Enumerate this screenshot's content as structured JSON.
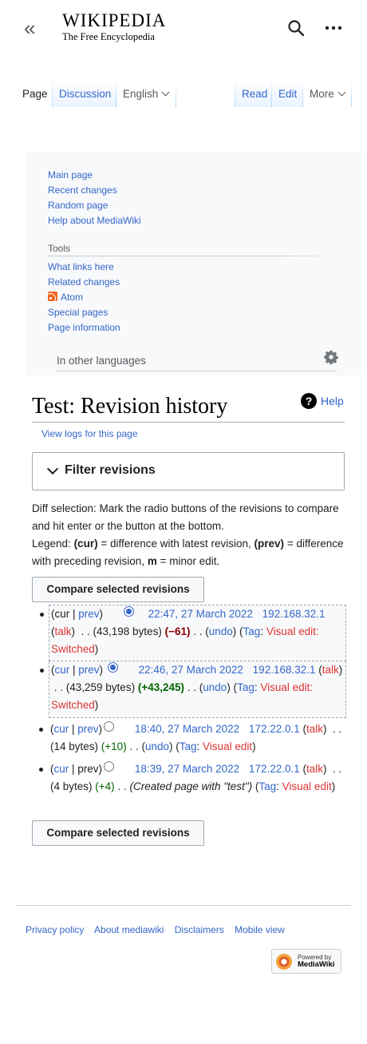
{
  "header": {
    "logo_word": "WIKIPEDIA",
    "logo_tagline": "The Free Encyclopedia",
    "collapse_glyph": "«",
    "icons": [
      "double-chevron-left-icon",
      "search-icon",
      "ellipsis-icon"
    ]
  },
  "tabs": {
    "page": "Page",
    "discussion": "Discussion",
    "language": "English",
    "read": "Read",
    "edit": "Edit",
    "more": "More"
  },
  "sidebar": {
    "nav": [
      "Main page",
      "Recent changes",
      "Random page",
      "Help about MediaWiki"
    ],
    "tools_heading": "Tools",
    "tools": [
      "What links here",
      "Related changes",
      "Atom",
      "Special pages",
      "Page information"
    ],
    "other_languages": "In other languages"
  },
  "page": {
    "title": "Test: Revision history",
    "help": "Help",
    "view_logs": "View logs for this page",
    "filter_label": "Filter revisions",
    "diff_selection": "Diff selection: Mark the radio buttons of the revisions to compare and hit enter or the button at the bottom.",
    "legend_prefix": "Legend: ",
    "legend_cur": "(cur)",
    "legend_cur_desc": " = difference with latest revision, ",
    "legend_prev": "(prev)",
    "legend_prev_desc": " = difference with preceding revision, ",
    "legend_m": "m",
    "legend_m_desc": " = minor edit.",
    "compare_button": "Compare selected revisions"
  },
  "revisions": [
    {
      "cur": "cur",
      "prev": "prev",
      "date": "22:47, 27 March 2022",
      "user": "192.168.32.1",
      "talk": "talk",
      "bytes": "(43,198 bytes)",
      "delta": "(−61)",
      "delta_kind": "neg",
      "undo": "undo",
      "tag_label": "Tag",
      "tag": "Visual edit: Switched",
      "summary": ""
    },
    {
      "cur": "cur",
      "prev": "prev",
      "date": "22:46, 27 March 2022",
      "user": "192.168.32.1",
      "talk": "talk",
      "bytes": "(43,259 bytes)",
      "delta": "(+43,245)",
      "delta_kind": "posb",
      "undo": "undo",
      "tag_label": "Tag",
      "tag": "Visual edit: Switched",
      "summary": ""
    },
    {
      "cur": "cur",
      "prev": "prev",
      "date": "18:40, 27 March 2022",
      "user": "172.22.0.1",
      "talk": "talk",
      "bytes": "(14 bytes)",
      "delta": "(+10)",
      "delta_kind": "pos",
      "undo": "undo",
      "tag_label": "Tag",
      "tag": "Visual edit",
      "summary": ""
    },
    {
      "cur": "cur",
      "prev": "prev",
      "date": "18:39, 27 March 2022",
      "user": "172.22.0.1",
      "talk": "talk",
      "bytes": "(4 bytes)",
      "delta": "(+4)",
      "delta_kind": "pos",
      "undo": "",
      "tag_label": "Tag",
      "tag": "Visual edit",
      "summary": "(Created page with \"test\")"
    }
  ],
  "footer": {
    "links": [
      "Privacy policy",
      "About mediawiki",
      "Disclaimers",
      "Mobile view"
    ],
    "powered_by": "Powered by",
    "powered_name": "MediaWiki"
  },
  "colors": {
    "link": "#3366cc",
    "red_link": "#d33",
    "negative": "#8b0000",
    "positive": "#006400",
    "panel": "#f8f9fa"
  }
}
